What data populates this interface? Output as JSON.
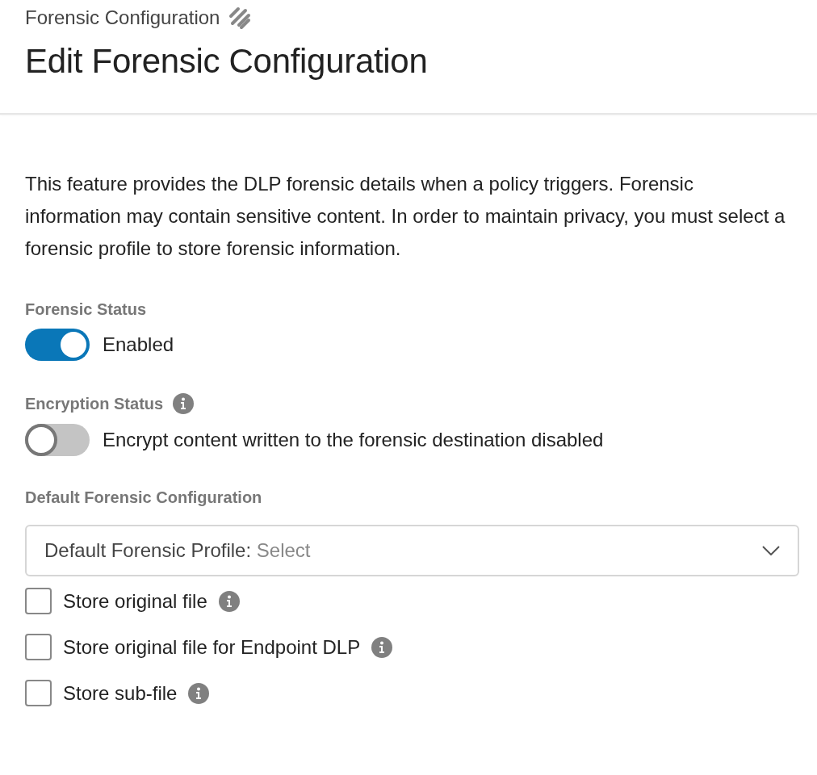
{
  "header": {
    "breadcrumb": "Forensic Configuration",
    "title": "Edit Forensic Configuration"
  },
  "description": "This feature provides the DLP forensic details when a policy triggers. Forensic information may contain sensitive content. In order to maintain privacy, you must select a forensic profile to store forensic information.",
  "settings": [
    {
      "label": "Forensic Status",
      "info": false,
      "toggle": {
        "on": true,
        "text": "Enabled"
      }
    },
    {
      "label": "Encryption Status",
      "info": true,
      "toggle": {
        "on": false,
        "text": "Encrypt content written to the forensic destination disabled"
      }
    }
  ],
  "default_configuration": {
    "label": "Default Forensic Configuration",
    "select": {
      "label": "Default Forensic Profile:",
      "placeholder": "Select"
    }
  },
  "options": [
    {
      "label": "Store original file",
      "checked": false
    },
    {
      "label": "Store original file for Endpoint DLP",
      "checked": false
    },
    {
      "label": "Store sub-file",
      "checked": false
    }
  ]
}
